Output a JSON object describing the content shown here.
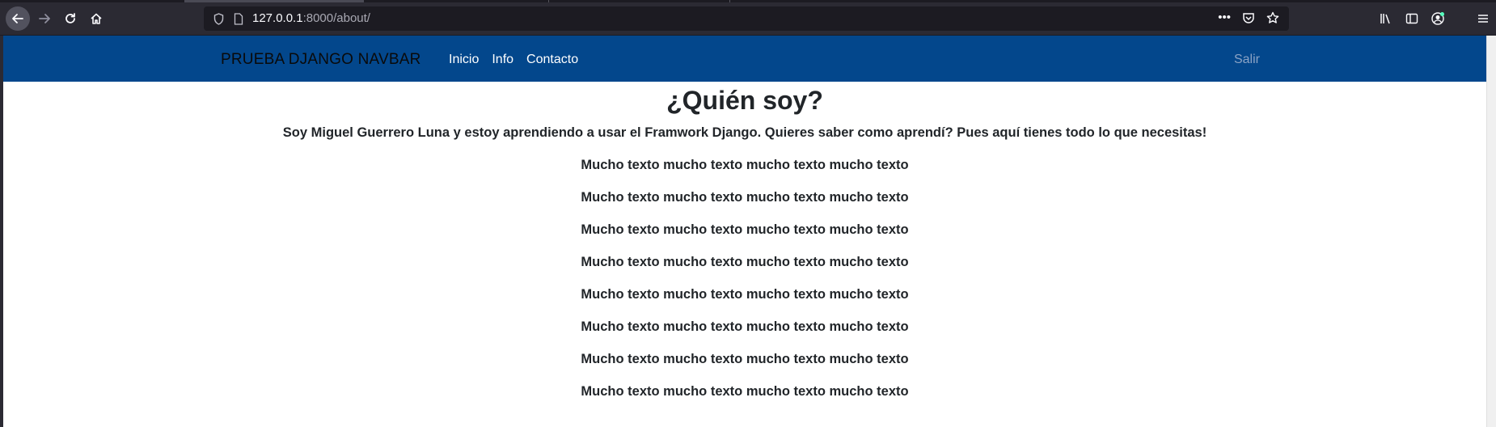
{
  "browser": {
    "url_host": "127.0.0.1",
    "url_path": ":8000/about/"
  },
  "navbar": {
    "brand": "PRUEBA DJANGO NAVBAR",
    "links": [
      "Inicio",
      "Info",
      "Contacto"
    ],
    "logout": "Salir",
    "background_color": "#03478c"
  },
  "content": {
    "title": "¿Quién soy?",
    "intro": "Soy Miguel Guerrero Luna y estoy aprendiendo a usar el Framwork Django. Quieres saber como aprendí? Pues aquí tienes todo lo que necesitas!",
    "paragraphs": [
      "Mucho texto mucho texto mucho texto mucho texto",
      "Mucho texto mucho texto mucho texto mucho texto",
      "Mucho texto mucho texto mucho texto mucho texto",
      "Mucho texto mucho texto mucho texto mucho texto",
      "Mucho texto mucho texto mucho texto mucho texto",
      "Mucho texto mucho texto mucho texto mucho texto",
      "Mucho texto mucho texto mucho texto mucho texto",
      "Mucho texto mucho texto mucho texto mucho texto"
    ]
  }
}
